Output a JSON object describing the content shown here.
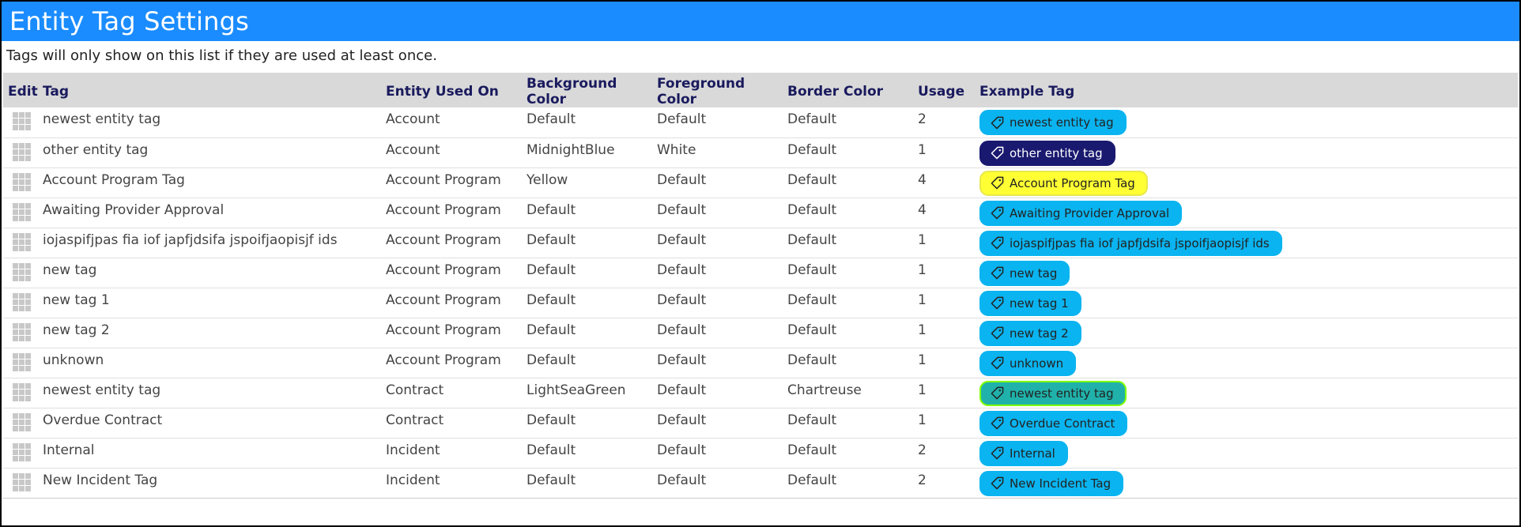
{
  "header": {
    "title": "Entity Tag Settings"
  },
  "notice": "Tags will only show on this list if they are used at least once.",
  "table": {
    "columns": [
      "Edit",
      "Tag",
      "Entity Used On",
      "Background Color",
      "Foreground Color",
      "Border Color",
      "Usage",
      "Example Tag"
    ],
    "rows": [
      {
        "tag": "newest entity tag",
        "entity": "Account",
        "bg": "Default",
        "fg": "Default",
        "border": "Default",
        "usage": "2",
        "pill": {
          "label": "newest entity tag",
          "bg_color": "#0ab4f0",
          "fg_color": "#222222",
          "border_color": "#0ab4f0"
        }
      },
      {
        "tag": "other entity tag",
        "entity": "Account",
        "bg": "MidnightBlue",
        "fg": "White",
        "border": "Default",
        "usage": "1",
        "pill": {
          "label": "other entity tag",
          "bg_color": "#191970",
          "fg_color": "#ffffff",
          "border_color": "#191970"
        }
      },
      {
        "tag": "Account Program Tag",
        "entity": "Account Program",
        "bg": "Yellow",
        "fg": "Default",
        "border": "Default",
        "usage": "4",
        "pill": {
          "label": "Account Program Tag",
          "bg_color": "#ffff33",
          "fg_color": "#222222",
          "border_color": "#e8e84d"
        }
      },
      {
        "tag": "Awaiting Provider Approval",
        "entity": "Account Program",
        "bg": "Default",
        "fg": "Default",
        "border": "Default",
        "usage": "4",
        "pill": {
          "label": "Awaiting Provider Approval",
          "bg_color": "#0ab4f0",
          "fg_color": "#222222",
          "border_color": "#0ab4f0"
        }
      },
      {
        "tag": "iojaspifjpas fia iof japfjdsifa jspoifjaopisjf ids",
        "entity": "Account Program",
        "bg": "Default",
        "fg": "Default",
        "border": "Default",
        "usage": "1",
        "pill": {
          "label": "iojaspifjpas fia iof japfjdsifa jspoifjaopisjf ids",
          "bg_color": "#0ab4f0",
          "fg_color": "#222222",
          "border_color": "#0ab4f0"
        }
      },
      {
        "tag": "new tag",
        "entity": "Account Program",
        "bg": "Default",
        "fg": "Default",
        "border": "Default",
        "usage": "1",
        "pill": {
          "label": "new tag",
          "bg_color": "#0ab4f0",
          "fg_color": "#222222",
          "border_color": "#0ab4f0"
        }
      },
      {
        "tag": "new tag 1",
        "entity": "Account Program",
        "bg": "Default",
        "fg": "Default",
        "border": "Default",
        "usage": "1",
        "pill": {
          "label": "new tag 1",
          "bg_color": "#0ab4f0",
          "fg_color": "#222222",
          "border_color": "#0ab4f0"
        }
      },
      {
        "tag": "new tag 2",
        "entity": "Account Program",
        "bg": "Default",
        "fg": "Default",
        "border": "Default",
        "usage": "1",
        "pill": {
          "label": "new tag 2",
          "bg_color": "#0ab4f0",
          "fg_color": "#222222",
          "border_color": "#0ab4f0"
        }
      },
      {
        "tag": "unknown",
        "entity": "Account Program",
        "bg": "Default",
        "fg": "Default",
        "border": "Default",
        "usage": "1",
        "pill": {
          "label": "unknown",
          "bg_color": "#0ab4f0",
          "fg_color": "#222222",
          "border_color": "#0ab4f0"
        }
      },
      {
        "tag": "newest entity tag",
        "entity": "Contract",
        "bg": "LightSeaGreen",
        "fg": "Default",
        "border": "Chartreuse",
        "usage": "1",
        "pill": {
          "label": "newest entity tag",
          "bg_color": "#20b2aa",
          "fg_color": "#222222",
          "border_color": "#7fff00"
        }
      },
      {
        "tag": "Overdue Contract",
        "entity": "Contract",
        "bg": "Default",
        "fg": "Default",
        "border": "Default",
        "usage": "1",
        "pill": {
          "label": "Overdue Contract",
          "bg_color": "#0ab4f0",
          "fg_color": "#222222",
          "border_color": "#0ab4f0"
        }
      },
      {
        "tag": "Internal",
        "entity": "Incident",
        "bg": "Default",
        "fg": "Default",
        "border": "Default",
        "usage": "2",
        "pill": {
          "label": "Internal",
          "bg_color": "#0ab4f0",
          "fg_color": "#222222",
          "border_color": "#0ab4f0"
        }
      },
      {
        "tag": "New Incident Tag",
        "entity": "Incident",
        "bg": "Default",
        "fg": "Default",
        "border": "Default",
        "usage": "2",
        "pill": {
          "label": "New Incident Tag",
          "bg_color": "#0ab4f0",
          "fg_color": "#222222",
          "border_color": "#0ab4f0"
        }
      }
    ]
  },
  "icons": {
    "edit": "grid-edit-icon",
    "tag": "tag-icon"
  }
}
